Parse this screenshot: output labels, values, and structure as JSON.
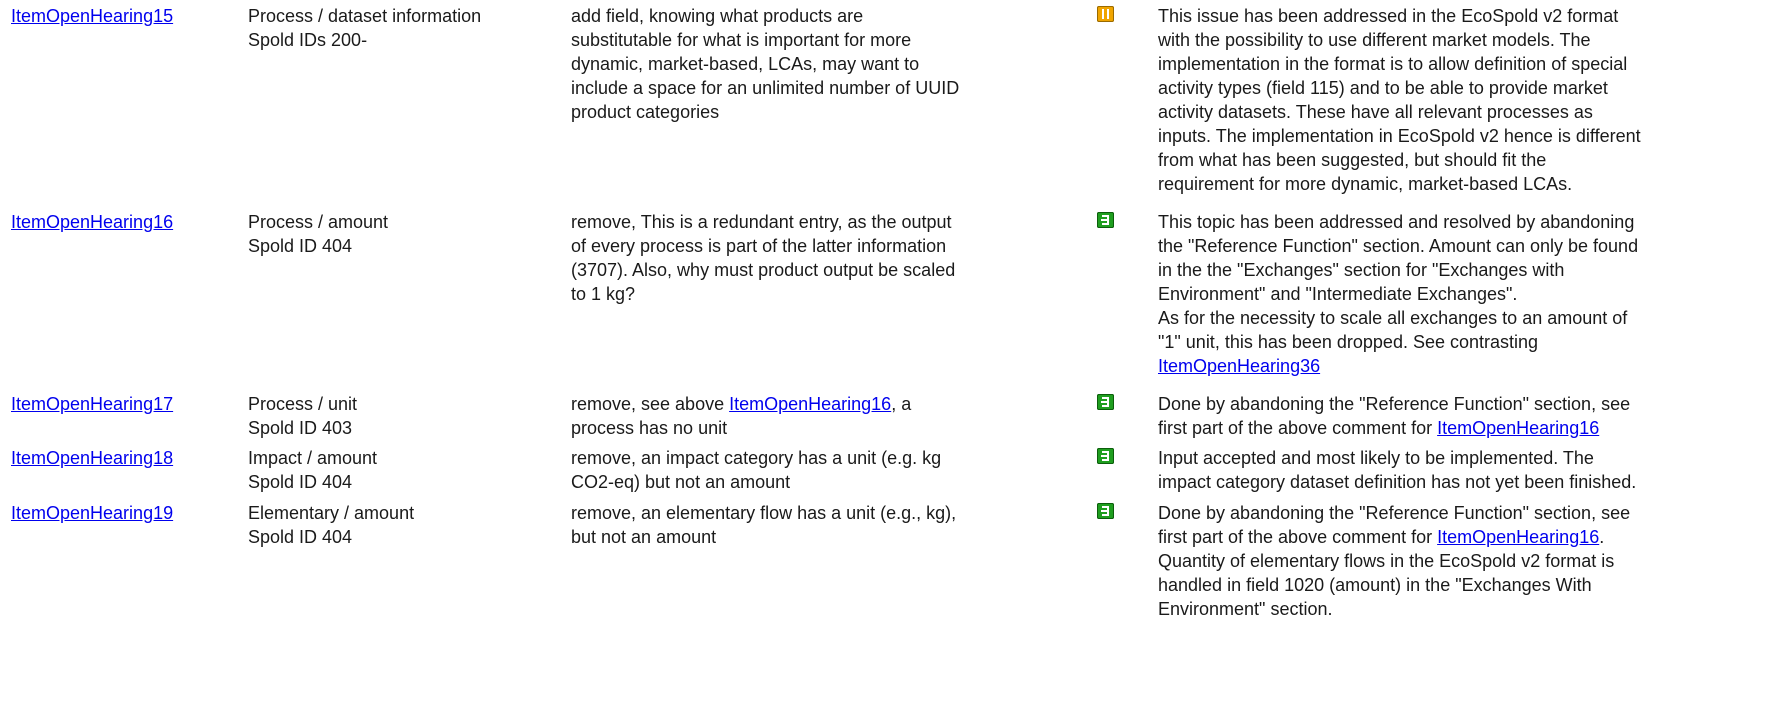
{
  "rows": [
    {
      "id": "ItemOpenHearing15",
      "area": [
        "Process / dataset information",
        "Spold IDs 200-"
      ],
      "request": [
        "add field, knowing what products are",
        "substitutable for what is important for more",
        "dynamic, market-based, LCAs, may want to",
        "include a space for an unlimited number of UUID",
        "product categories"
      ],
      "status": "open",
      "comment": [
        "This issue has been addressed in the EcoSpold v2 format",
        "with the possibility to use different market models. The",
        "implementation in the format is to allow definition of special",
        "activity types (field 115) and to be able to provide market",
        "activity datasets. These have all relevant processes as",
        "inputs. The implementation in EcoSpold v2 hence is different",
        "from what has been suggested, but should fit the",
        "requirement for more dynamic, market-based LCAs."
      ]
    },
    {
      "id": "ItemOpenHearing16",
      "area": [
        "Process / amount",
        "Spold ID 404"
      ],
      "request": [
        "remove, This is a redundant entry, as the output",
        "of every process is part of the latter information",
        "(3707). Also, why must product output be scaled",
        "to 1 kg?"
      ],
      "status": "done",
      "comment": [
        "This topic has been addressed and resolved by abandoning",
        "the \"Reference Function\" section. Amount can only be found",
        "in the the \"Exchanges\" section for \"Exchanges with",
        "Environment\" and \"Intermediate Exchanges\".",
        "As for the necessity to scale all exchanges to an amount of",
        "\"1\" unit, this has been dropped. See contrasting"
      ],
      "comment_link": "ItemOpenHearing36"
    },
    {
      "id": "ItemOpenHearing17",
      "area": [
        "Process / unit",
        "Spold ID 403"
      ],
      "request_prefix": "remove, see above ",
      "request_link": "ItemOpenHearing16",
      "request_suffix": ", a",
      "request_line2": "process has no unit",
      "status": "done",
      "comment_line1": "Done by abandoning the \"Reference Function\" section, see",
      "comment_line2_prefix": "first part of the above comment for ",
      "comment_link": "ItemOpenHearing16"
    },
    {
      "id": "ItemOpenHearing18",
      "area": [
        "Impact / amount",
        "Spold ID 404"
      ],
      "request": [
        "remove, an impact category has a unit (e.g. kg",
        "CO2-eq) but not an amount"
      ],
      "status": "done",
      "comment": [
        "Input accepted and most likely to be implemented. The",
        "impact category dataset definition has not yet been finished."
      ]
    },
    {
      "id": "ItemOpenHearing19",
      "area": [
        "Elementary / amount",
        "Spold ID 404"
      ],
      "request": [
        "remove, an elementary flow has a unit (e.g., kg),",
        "but not an amount"
      ],
      "status": "done",
      "comment_line1": "Done by abandoning the \"Reference Function\" section, see",
      "comment_line2_prefix": "first part of the above comment for ",
      "comment_link": "ItemOpenHearing16",
      "comment_line2_suffix": ".",
      "comment_rest": [
        "Quantity of elementary flows in the EcoSpold v2 format is",
        "handled in field 1020 (amount) in the \"Exchanges With",
        "Environment\" section."
      ]
    }
  ],
  "status_icons": {
    "open": "open-status-icon",
    "done": "done-status-icon"
  },
  "colors": {
    "link": "#0000ee",
    "open": "#f0a500",
    "done": "#1f9e1f"
  }
}
